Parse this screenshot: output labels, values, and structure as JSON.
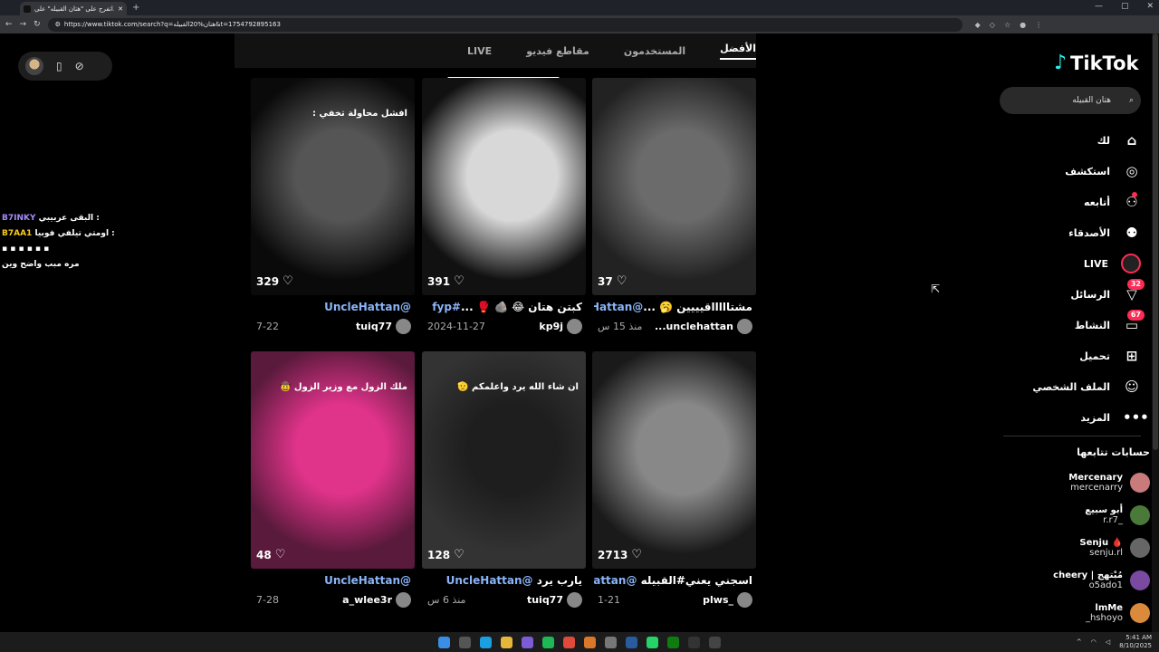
{
  "browser": {
    "tab_title": "اتفرج على \"هتان القبيله\" على...",
    "url": "https://www.tiktok.com/search?q=هتان%20القبيله&t=1754792895163"
  },
  "search_tabs": [
    "LIVE",
    "مقاطع فيديو",
    "المستخدمون",
    "الأفضل"
  ],
  "overlay_chat": {
    "line1_name": "B7INKY",
    "line1_text": "البقى عربيبي :",
    "line2_name": "B7AA1",
    "line2_text": "اومتي تيلفي فوبيا :",
    "line3_text": "مره مبب واضح وين"
  },
  "videos": [
    {
      "likes": "37",
      "desc_tag": "@UncleHattan",
      "desc_text": " مشتاااااقيييين 🥱 ...",
      "user": "unclehattan...",
      "date": "منذ 15 س",
      "colors": [
        "#6b6b6b",
        "#222"
      ]
    },
    {
      "likes": "391",
      "desc_tag": "#fyp",
      "desc_text": "كبتن هتان 😂 🪨 🥊 ...",
      "user": "kp9j",
      "date": "2024-11-27",
      "colors": [
        "#d8d8d8",
        "#111"
      ]
    },
    {
      "likes": "329",
      "desc_tag": "@UncleHattan",
      "desc_text": "",
      "user": "tuiq77",
      "date": "7-22",
      "colors": [
        "#555",
        "#0a0a0a"
      ],
      "caption": "افشل محاولة تخفي :"
    },
    {
      "likes": "2713",
      "desc_tag": "@UncleHattan",
      "desc_text": "اسجني يعني#القبيله ",
      "user": "_plws",
      "date": "1-21",
      "colors": [
        "#888",
        "#1a1a1a"
      ]
    },
    {
      "likes": "128",
      "desc_tag": "@UncleHattan",
      "desc_text": "يارب يرد ",
      "user": "tuiq77",
      "date": "منذ 6 س",
      "colors": [
        "#1e1e1e",
        "#333"
      ],
      "caption": "ان شاء الله يرد واعلمكم 🫡"
    },
    {
      "likes": "48",
      "desc_tag": "@UncleHattan",
      "desc_text": "",
      "user": "a_wlee3r",
      "date": "7-28",
      "colors": [
        "#e0338a",
        "#5a1a3c"
      ],
      "caption": "ملك الزول مع وزير الزول 🤠"
    }
  ],
  "sidebar": {
    "logo": "TikTok",
    "search_value": "هتان القبيله",
    "nav": [
      {
        "label": "لك",
        "icon": "⌂"
      },
      {
        "label": "استكشف",
        "icon": "◎"
      },
      {
        "label": "أتابعه",
        "icon": "⚇"
      },
      {
        "label": "الأصدقاء",
        "icon": "⚉"
      },
      {
        "label": "LIVE",
        "icon": ""
      },
      {
        "label": "الرسائل",
        "icon": "▽",
        "badge": "32"
      },
      {
        "label": "النشاط",
        "icon": "▭",
        "badge": "67"
      },
      {
        "label": "تحميل",
        "icon": "⊞"
      },
      {
        "label": "الملف الشخصي",
        "icon": "☺"
      },
      {
        "label": "المزيد",
        "icon": "•••"
      }
    ],
    "following_title": "حسابات تتابعها",
    "following": [
      {
        "name": "Mercenary",
        "handle": "mercenarry",
        "color": "#c97a7a"
      },
      {
        "name": "أبو سبيع",
        "handle": "r.r7_",
        "color": "#4a7a3a"
      },
      {
        "name": "Senju 🩸",
        "handle": "senju.rl",
        "color": "#666"
      },
      {
        "name": "cheery | مُبْتهج",
        "handle": "o5ado1",
        "color": "#7a4aa0"
      },
      {
        "name": "lmMe",
        "handle": "_hshoyo",
        "color": "#d98a3a"
      }
    ]
  },
  "taskbar": {
    "time": "5:41 AM",
    "date": "8/10/2025"
  }
}
